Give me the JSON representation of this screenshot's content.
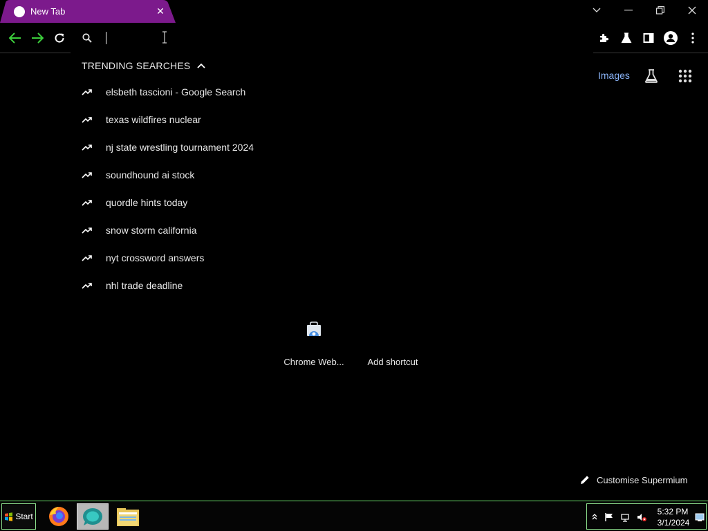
{
  "tab": {
    "title": "New Tab",
    "accent": "#7c1a8c"
  },
  "omnibox": {
    "value": "",
    "placeholder": ""
  },
  "dropdown": {
    "header": "TRENDING SEARCHES",
    "suggestions": [
      "elsbeth tascioni - Google Search",
      "texas wildfires nuclear",
      "nj state wrestling tournament 2024",
      "soundhound ai stock",
      "quordle hints today",
      "snow storm california",
      "nyt crossword answers",
      "nhl trade deadline"
    ]
  },
  "page": {
    "images_link": "Images",
    "link_color": "#8ab4f8",
    "shortcuts": [
      {
        "label": "Chrome Web...",
        "icon": "chrome-web-store-icon"
      },
      {
        "label": "Add shortcut",
        "icon": "add-shortcut-icon"
      }
    ],
    "customise": "Customise Supermium"
  },
  "taskbar": {
    "start_label": "Start",
    "apps": [
      "firefox-icon",
      "browser-icon",
      "file-explorer-icon"
    ],
    "clock_time": "5:32 PM",
    "clock_date": "3/1/2024",
    "border_color": "#6ee16e"
  }
}
